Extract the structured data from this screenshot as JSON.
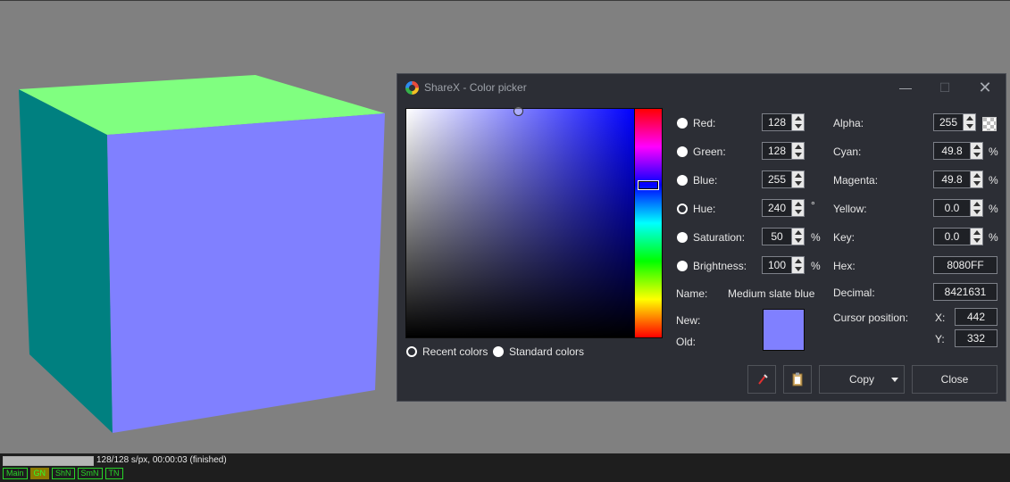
{
  "window": {
    "title": "ShareX - Color picker",
    "controls": {
      "minimize": "—",
      "maximize": "☐",
      "close": "✕"
    }
  },
  "picker": {
    "mode_options": [
      {
        "label": "Red:",
        "value": "128",
        "unit": "",
        "checked": false
      },
      {
        "label": "Green:",
        "value": "128",
        "unit": "",
        "checked": false
      },
      {
        "label": "Blue:",
        "value": "255",
        "unit": "",
        "checked": false
      },
      {
        "label": "Hue:",
        "value": "240",
        "unit": "°",
        "checked": true
      },
      {
        "label": "Saturation:",
        "value": "50",
        "unit": "%",
        "checked": false
      },
      {
        "label": "Brightness:",
        "value": "100",
        "unit": "%",
        "checked": false
      }
    ],
    "alpha": {
      "label": "Alpha:",
      "value": "255"
    },
    "cmyk": [
      {
        "label": "Cyan:",
        "value": "49.8",
        "unit": "%"
      },
      {
        "label": "Magenta:",
        "value": "49.8",
        "unit": "%"
      },
      {
        "label": "Yellow:",
        "value": "0.0",
        "unit": "%"
      },
      {
        "label": "Key:",
        "value": "0.0",
        "unit": "%"
      }
    ],
    "hex": {
      "label": "Hex:",
      "value": "8080FF"
    },
    "decimal": {
      "label": "Decimal:",
      "value": "8421631"
    },
    "name": {
      "label": "Name:",
      "value": "Medium slate blue"
    },
    "new_label": "New:",
    "old_label": "Old:",
    "new_color": "#8080FF",
    "old_color": "#8080FF",
    "cursor": {
      "label": "Cursor position:",
      "x_label": "X:",
      "x": "442",
      "y_label": "Y:",
      "y": "332"
    },
    "palette_options": {
      "recent": "Recent colors",
      "standard": "Standard colors"
    },
    "buttons": {
      "copy": "Copy",
      "close": "Close",
      "pipette_icon": "pipette-icon",
      "clipboard_icon": "clipboard-icon"
    }
  },
  "scene": {
    "top_color": "#80FF80",
    "front_color": "#8080FF",
    "side_color": "#008080",
    "background_color": "#808080"
  },
  "status": {
    "text": "128/128 s/px, 00:00:03 (finished)",
    "progress": 1.0,
    "tabs": [
      "Main",
      "GN",
      "ShN",
      "SmN",
      "TN"
    ],
    "active_tab": "GN"
  }
}
